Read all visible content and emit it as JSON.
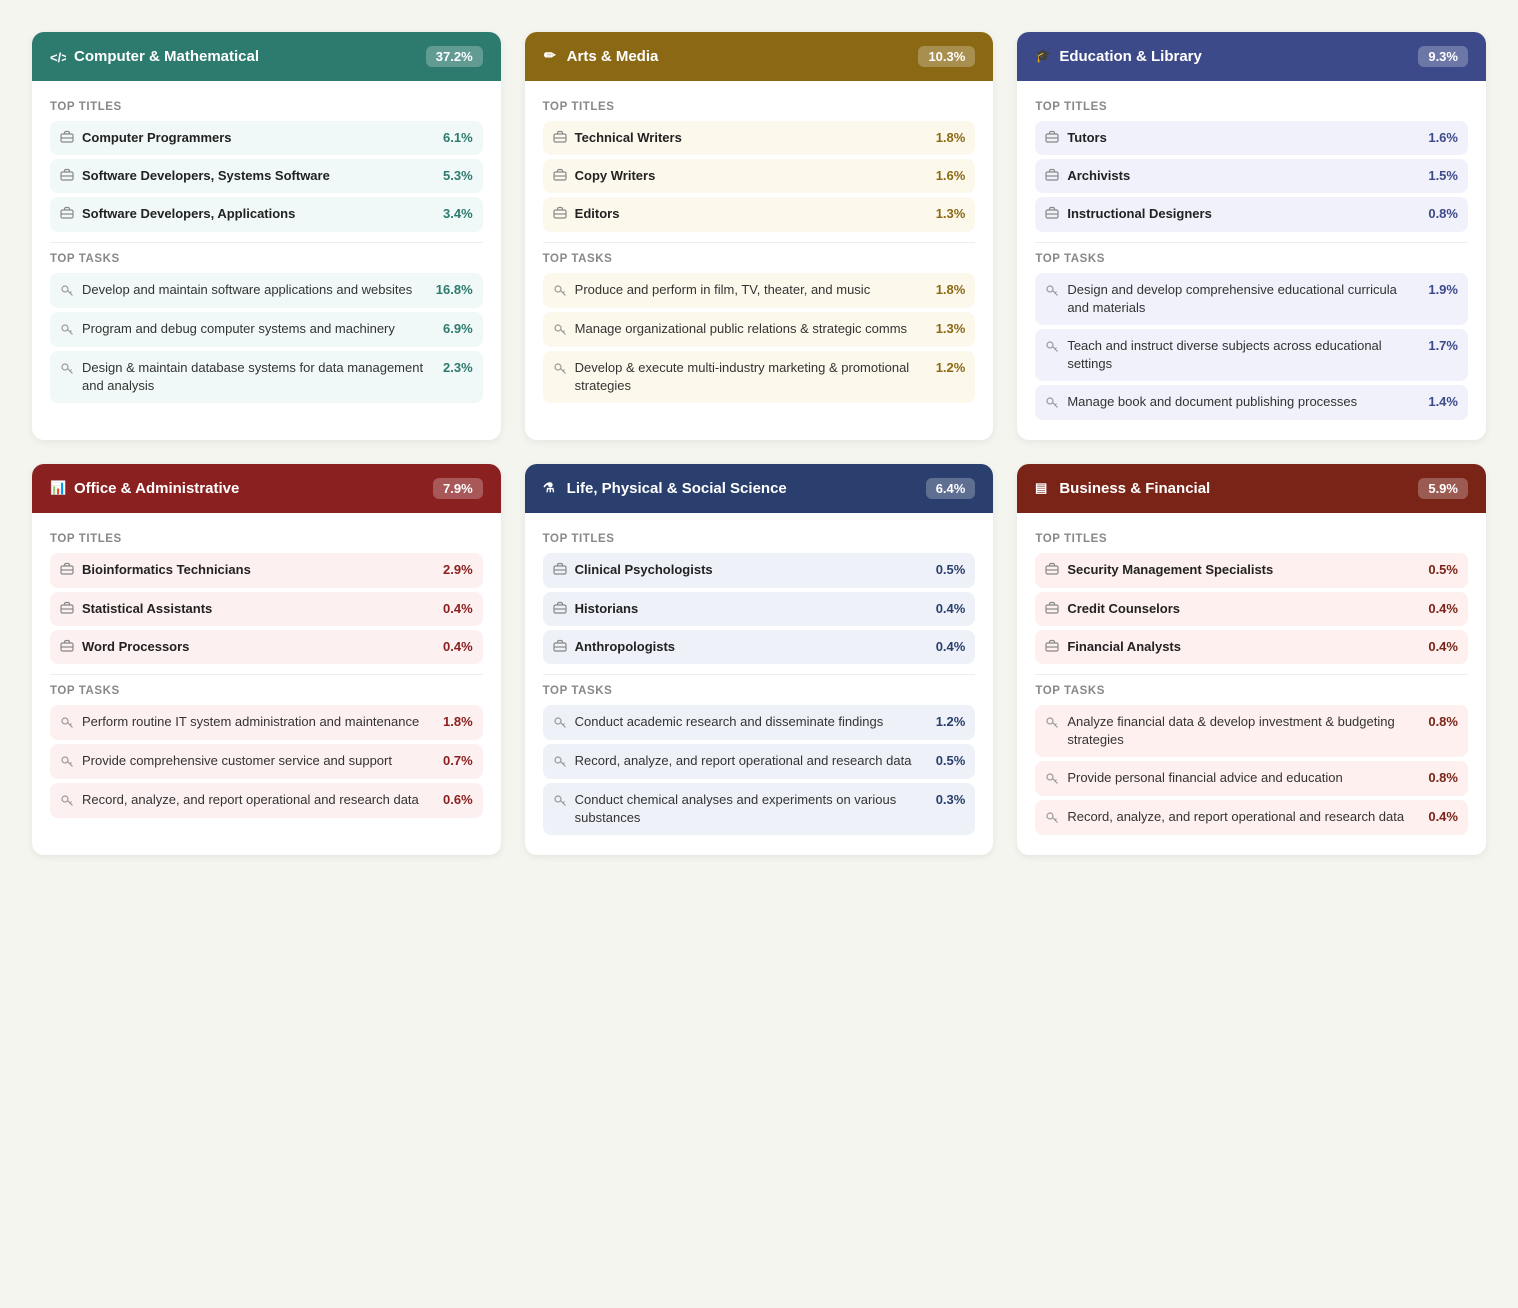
{
  "cards": [
    {
      "id": "computer-mathematical",
      "theme": "theme-green",
      "icon": "</>",
      "title": "Computer & Mathematical",
      "badge": "37.2%",
      "titles_label": "Top Titles",
      "titles": [
        {
          "icon": "🗂",
          "text": "Computer Programmers",
          "pct": "6.1%"
        },
        {
          "icon": "🗂",
          "text": "Software Developers, Systems Software",
          "pct": "5.3%"
        },
        {
          "icon": "🗂",
          "text": "Software Developers, Applications",
          "pct": "3.4%"
        }
      ],
      "tasks_label": "Top Tasks",
      "tasks": [
        {
          "icon": "🔧",
          "text": "Develop and maintain software applications and websites",
          "pct": "16.8%"
        },
        {
          "icon": "🔧",
          "text": "Program and debug computer systems and machinery",
          "pct": "6.9%"
        },
        {
          "icon": "🔧",
          "text": "Design & maintain database systems for data management and analysis",
          "pct": "2.3%"
        }
      ]
    },
    {
      "id": "arts-media",
      "theme": "theme-brown",
      "icon": "✎",
      "title": "Arts & Media",
      "badge": "10.3%",
      "titles_label": "Top Titles",
      "titles": [
        {
          "icon": "🗂",
          "text": "Technical Writers",
          "pct": "1.8%"
        },
        {
          "icon": "🗂",
          "text": "Copy Writers",
          "pct": "1.6%"
        },
        {
          "icon": "🗂",
          "text": "Editors",
          "pct": "1.3%"
        }
      ],
      "tasks_label": "Top Tasks",
      "tasks": [
        {
          "icon": "🔧",
          "text": "Produce and perform in film, TV, theater, and music",
          "pct": "1.8%"
        },
        {
          "icon": "🔧",
          "text": "Manage organizational public relations & strategic comms",
          "pct": "1.3%"
        },
        {
          "icon": "🔧",
          "text": "Develop & execute multi-industry marketing & promotional strategies",
          "pct": "1.2%"
        }
      ]
    },
    {
      "id": "education-library",
      "theme": "theme-indigo",
      "icon": "🎓",
      "title": "Education & Library",
      "badge": "9.3%",
      "titles_label": "Top Titles",
      "titles": [
        {
          "icon": "🗂",
          "text": "Tutors",
          "pct": "1.6%"
        },
        {
          "icon": "🗂",
          "text": "Archivists",
          "pct": "1.5%"
        },
        {
          "icon": "🗂",
          "text": "Instructional Designers",
          "pct": "0.8%"
        }
      ],
      "tasks_label": "Top Tasks",
      "tasks": [
        {
          "icon": "🔧",
          "text": "Design and develop comprehensive educational curricula and materials",
          "pct": "1.9%"
        },
        {
          "icon": "🔧",
          "text": "Teach and instruct diverse subjects across educational settings",
          "pct": "1.7%"
        },
        {
          "icon": "🔧",
          "text": "Manage book and document publishing processes",
          "pct": "1.4%"
        }
      ]
    },
    {
      "id": "office-administrative",
      "theme": "theme-red",
      "icon": "📊",
      "title": "Office & Administrative",
      "badge": "7.9%",
      "titles_label": "Top Titles",
      "titles": [
        {
          "icon": "🗂",
          "text": "Bioinformatics Technicians",
          "pct": "2.9%"
        },
        {
          "icon": "🗂",
          "text": "Statistical Assistants",
          "pct": "0.4%"
        },
        {
          "icon": "🗂",
          "text": "Word Processors",
          "pct": "0.4%"
        }
      ],
      "tasks_label": "Top Tasks",
      "tasks": [
        {
          "icon": "🔧",
          "text": "Perform routine IT system administration and maintenance",
          "pct": "1.8%"
        },
        {
          "icon": "🔧",
          "text": "Provide comprehensive customer service and support",
          "pct": "0.7%"
        },
        {
          "icon": "🔧",
          "text": "Record, analyze, and report operational and research data",
          "pct": "0.6%"
        }
      ]
    },
    {
      "id": "life-physical-social",
      "theme": "theme-navy",
      "icon": "⚗",
      "title": "Life, Physical & Social Science",
      "badge": "6.4%",
      "titles_label": "Top Titles",
      "titles": [
        {
          "icon": "🗂",
          "text": "Clinical Psychologists",
          "pct": "0.5%"
        },
        {
          "icon": "🗂",
          "text": "Historians",
          "pct": "0.4%"
        },
        {
          "icon": "🗂",
          "text": "Anthropologists",
          "pct": "0.4%"
        }
      ],
      "tasks_label": "Top Tasks",
      "tasks": [
        {
          "icon": "🔧",
          "text": "Conduct academic research and disseminate findings",
          "pct": "1.2%"
        },
        {
          "icon": "🔧",
          "text": "Record, analyze, and report operational and research data",
          "pct": "0.5%"
        },
        {
          "icon": "🔧",
          "text": "Conduct chemical analyses and experiments on various substances",
          "pct": "0.3%"
        }
      ]
    },
    {
      "id": "business-financial",
      "theme": "theme-darkred",
      "icon": "≡",
      "title": "Business & Financial",
      "badge": "5.9%",
      "titles_label": "Top Titles",
      "titles": [
        {
          "icon": "🗂",
          "text": "Security Management Specialists",
          "pct": "0.5%"
        },
        {
          "icon": "🗂",
          "text": "Credit Counselors",
          "pct": "0.4%"
        },
        {
          "icon": "🗂",
          "text": "Financial Analysts",
          "pct": "0.4%"
        }
      ],
      "tasks_label": "Top Tasks",
      "tasks": [
        {
          "icon": "🔧",
          "text": "Analyze financial data & develop investment & budgeting strategies",
          "pct": "0.8%"
        },
        {
          "icon": "🔧",
          "text": "Provide personal financial advice and education",
          "pct": "0.8%"
        },
        {
          "icon": "🔧",
          "text": "Record, analyze, and report operational and research data",
          "pct": "0.4%"
        }
      ]
    }
  ]
}
